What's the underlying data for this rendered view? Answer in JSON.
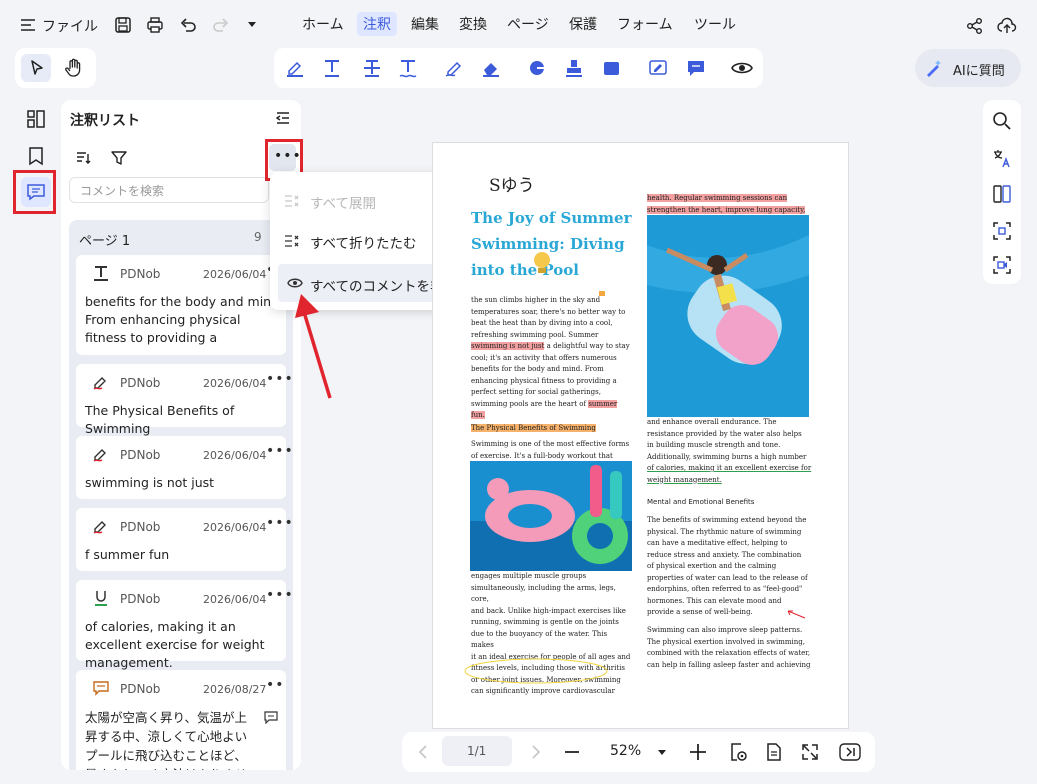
{
  "topbar": {
    "file_label": "ファイル",
    "menu": [
      "ホーム",
      "注釈",
      "編集",
      "変換",
      "ページ",
      "保護",
      "フォーム",
      "ツール"
    ],
    "active_menu": "注釈",
    "ai_button": "AIに質問"
  },
  "panel": {
    "title": "注釈リスト",
    "search_placeholder": "コメントを検索",
    "page_label": "ページ 1",
    "page_count": "9",
    "cards": [
      {
        "icon": "text-icon",
        "author": "PDNob",
        "date": "2026/06/04",
        "text": "benefits for the body and mind. From enhancing physical fitness to providing a"
      },
      {
        "icon": "highlight-pen-icon",
        "author": "PDNob",
        "date": "2026/06/04",
        "text": "The Physical Benefits of Swimming"
      },
      {
        "icon": "highlight-pen-icon",
        "author": "PDNob",
        "date": "2026/06/04",
        "text": "swimming is not just"
      },
      {
        "icon": "highlight-pen-icon",
        "author": "PDNob",
        "date": "2026/06/04",
        "text": "f summer fun"
      },
      {
        "icon": "underline-icon",
        "author": "PDNob",
        "date": "2026/06/04",
        "text": "of calories, making it an excellent exercise for weight management."
      },
      {
        "icon": "comment-icon",
        "author": "PDNob",
        "date": "2026/08/27",
        "text": "太陽が空高く昇り、気温が上昇する中、涼しくて心地よいプールに飛び込むことほど、暑さをしのぐ方法はありません。夏の"
      }
    ]
  },
  "dropdown": {
    "expand_all": "すべて展開",
    "collapse_all": "すべて折りたたむ",
    "hide_all": "すべてのコメントを非表示"
  },
  "document": {
    "handwriting": "Sゆう",
    "title": "The Joy of Summer Swimming: Diving into the Pool",
    "col1_intro": [
      "the sun climbs higher in the sky and",
      "temperatures soar, there's no better way to",
      "beat the heat than by diving into a cool,",
      "refreshing swimming pool. Summer",
      "swimming is not just",
      " a delightful way to stay",
      "cool; it's an activity that offers numerous",
      "benefits for the body and mind. From",
      "enhancing physical fitness to providing a",
      "perfect setting for social gatherings,",
      "swimming pools are the heart of ",
      "summer fun."
    ],
    "col1_heading": "The Physical Benefits of Swimming",
    "col1_a": [
      "Swimming is one of the most effective forms",
      "of exercise. It's a full-body workout that"
    ],
    "col1_b": [
      "engages multiple muscle groups",
      "simultaneously, including the arms, legs, core,",
      "and back. Unlike high-impact exercises like",
      "running, swimming is gentle on the joints",
      "due to the buoyancy of the water. This makes",
      "it an ideal exercise for people of all ages and",
      "fitness levels, including those with arthritis",
      "or other joint issues. Moreover, swimming",
      "can significantly improve cardiovascular"
    ],
    "col2_top": [
      "health. Regular swimming sessions can",
      "strengthen the heart, improve lung capacity,"
    ],
    "col2_a": [
      "and enhance overall endurance. The",
      "resistance provided by the water also helps",
      "in building muscle strength and tone.",
      "Additionally, swimming burns a high number",
      "of calories, making it an excellent exercise for",
      "weight management."
    ],
    "col2_heading": "Mental and Emotional Benefits",
    "col2_b": [
      "The benefits of swimming extend beyond the",
      "physical. The rhythmic nature of swimming",
      "can have a meditative effect, helping to",
      "reduce stress and anxiety. The combination",
      "of physical exertion and the calming",
      "properties of water can lead to the release of",
      "endorphins, often referred to as \"feel-good\"",
      "hormones. This can elevate mood and",
      "provide a sense of well-being."
    ],
    "col2_c": [
      "Swimming can also improve sleep patterns.",
      "The physical exertion involved in swimming,",
      "combined with the relaxation effects of water,",
      "can help in falling asleep faster and achieving"
    ]
  },
  "bottombar": {
    "page": "1/1",
    "zoom": "52%"
  },
  "colors": {
    "accent": "#3b5bdb",
    "annotation_red": "#e0252e",
    "title_blue": "#29a8d6"
  }
}
